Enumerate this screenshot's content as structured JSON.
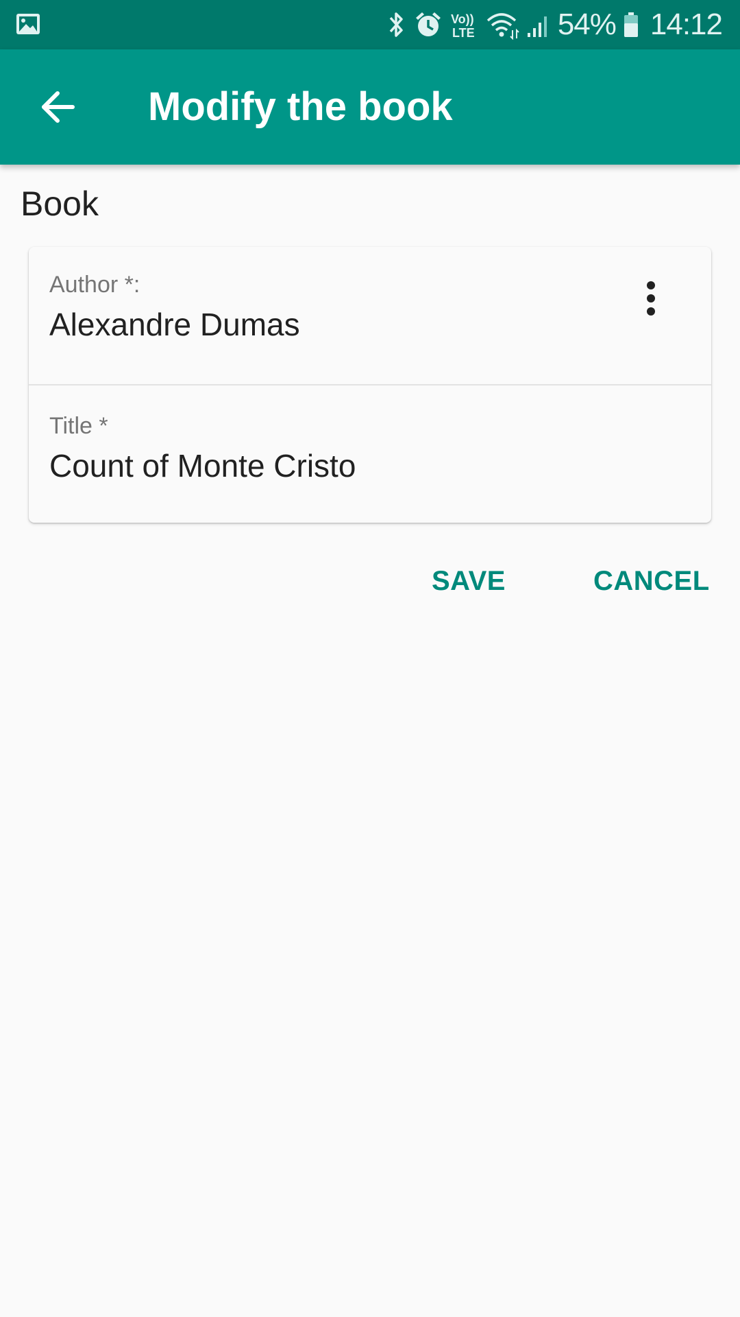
{
  "status_bar": {
    "icons": [
      "gallery-icon",
      "bluetooth-icon",
      "alarm-icon",
      "volte-icon",
      "wifi-icon",
      "signal-icon",
      "battery-icon"
    ],
    "volte_top": "Vo))",
    "volte_bottom": "LTE",
    "battery": "54%",
    "time": "14:12",
    "background": "#00796b"
  },
  "app_bar": {
    "title": "Modify the book",
    "back_icon": "arrow-back-icon",
    "background": "#009688"
  },
  "section": {
    "heading": "Book"
  },
  "form": {
    "author": {
      "label": "Author *:",
      "value": "Alexandre Dumas",
      "menu_icon": "more-vert-icon"
    },
    "title": {
      "label": "Title *",
      "value": "Count of Monte Cristo"
    }
  },
  "actions": {
    "save": "SAVE",
    "cancel": "CANCEL",
    "accent": "#00897b"
  }
}
